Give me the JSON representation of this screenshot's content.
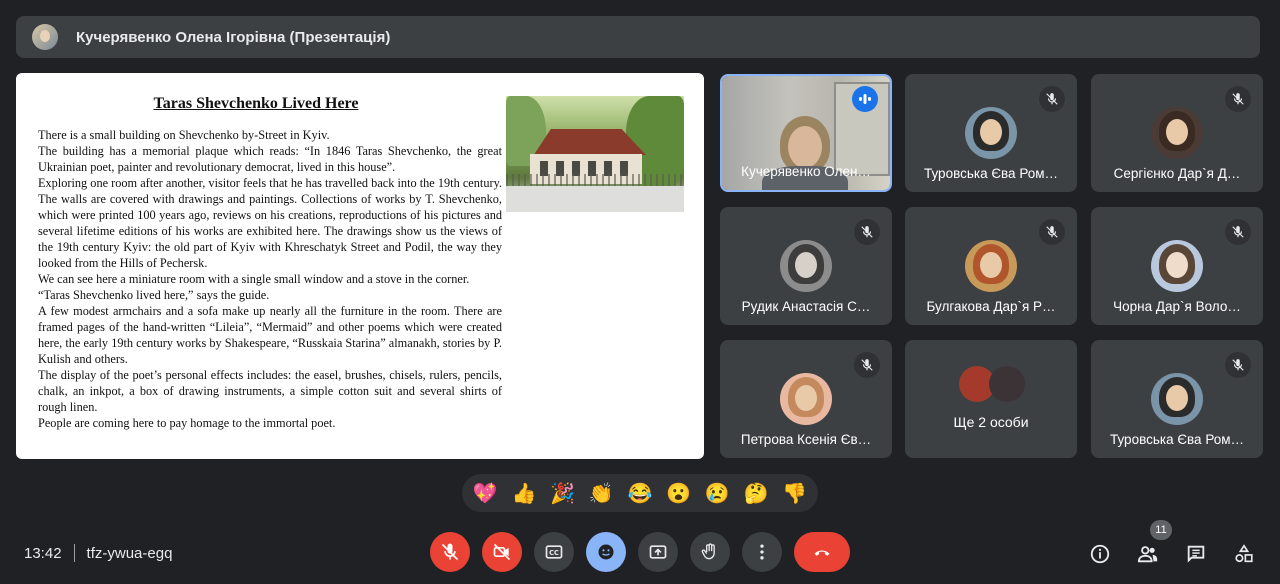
{
  "presenter": {
    "name": "Кучерявенко Олена Ігорівна (Презентація)"
  },
  "slide": {
    "title": "Taras Shevchenko Lived Here",
    "paragraphs": [
      "There is a small building on Shevchenko by-Street in Kyiv.",
      "The building has a memorial plaque which reads: “In 1846 Taras Shevchenko, the great Ukrainian poet, painter and revolutionary democrat, lived in this house”.",
      "Exploring one room after another, visitor feels that he has travelled back into the 19th century. The walls are covered with drawings and paintings. Collections of works by T. Shevchenko, which were printed 100 years ago, reviews on his creations, reproductions of his pictures and several lifetime editions of his works are exhibited here. The drawings show us the views of the 19th century Kyiv: the old part of Kyiv with Khreschatyk Street and Podil, the way they looked from the Hills of Pechersk.",
      "We can see here a miniature room with a single small window and a stove in the corner.",
      "“Taras Shevchenko lived here,” says the guide.",
      "A few modest armchairs and a sofa make up nearly all the furniture in the room. There are framed pages of the hand-written “Lileia”, “Mermaid” and other poems which were created here, the early 19th century works by Shakespeare, “Russkaia Starina” almanakh, stories by P. Kulish and others.",
      "The display of the poet’s personal effects includes: the easel, brushes, chisels, rulers, pencils, chalk, an inkpot, a box of drawing instruments, a simple cotton suit and several shirts of rough linen.",
      "People are coming here to pay homage to the immortal poet."
    ]
  },
  "participants": [
    {
      "name": "Кучерявенко Олен…"
    },
    {
      "name": "Туровська Єва Ром…"
    },
    {
      "name": "Сергієнко Дар`я Д…"
    },
    {
      "name": "Рудик Анастасія С…"
    },
    {
      "name": "Булгакова Дар`я Р…"
    },
    {
      "name": "Чорна Дар`я Воло…"
    },
    {
      "name": "Петрова Ксенія Єв…"
    },
    {
      "name": "Ще 2 особи"
    },
    {
      "name": "Туровська Єва Ром…"
    }
  ],
  "reactions": [
    "💖",
    "👍",
    "🎉",
    "👏",
    "😂",
    "😮",
    "😢",
    "🤔",
    "👎"
  ],
  "footer": {
    "time": "13:42",
    "meeting_code": "tfz-ywua-egq",
    "people_count": "11"
  },
  "colors": {
    "background": "#202124",
    "tile": "#3c4043",
    "danger": "#ea4335",
    "active": "#8ab4f8"
  }
}
